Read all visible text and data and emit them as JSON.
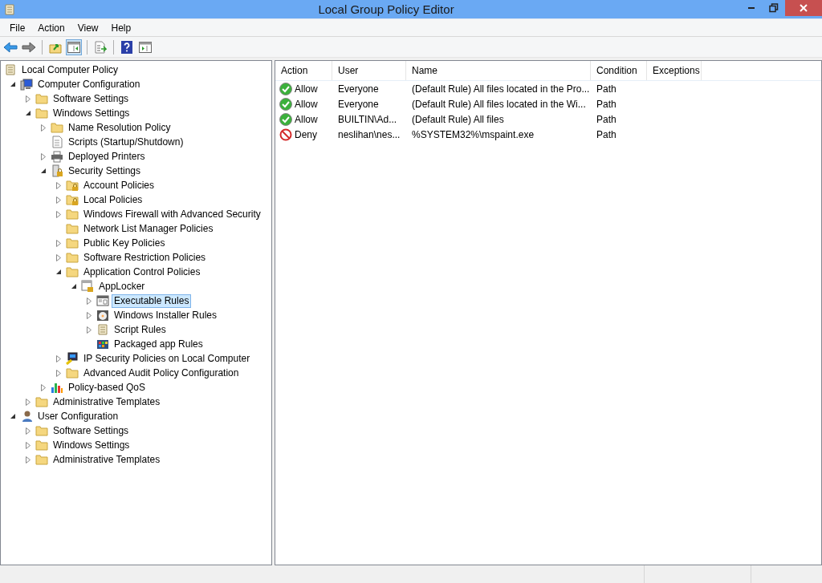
{
  "window": {
    "title": "Local Group Policy Editor"
  },
  "menu": [
    "File",
    "Action",
    "View",
    "Help"
  ],
  "toolbar": [
    {
      "kind": "back",
      "selected": false
    },
    {
      "kind": "forward",
      "selected": false
    },
    {
      "kind": "sep"
    },
    {
      "kind": "up-folder",
      "selected": false
    },
    {
      "kind": "show-tree",
      "selected": true
    },
    {
      "kind": "sep"
    },
    {
      "kind": "export",
      "selected": false
    },
    {
      "kind": "sep"
    },
    {
      "kind": "help",
      "selected": false
    },
    {
      "kind": "action-pane",
      "selected": false
    }
  ],
  "tree": [
    {
      "label": "Local Computer Policy",
      "kind": "scroll",
      "selected": false,
      "children": [
        {
          "label": "Computer Configuration",
          "kind": "computer",
          "selected": false,
          "expanded": true,
          "children": [
            {
              "label": "Software Settings",
              "kind": "folder",
              "selected": false,
              "expanded": false
            },
            {
              "label": "Windows Settings",
              "kind": "folder",
              "selected": false,
              "expanded": true,
              "children": [
                {
                  "label": "Name Resolution Policy",
                  "kind": "folder",
                  "selected": false,
                  "expanded": false
                },
                {
                  "label": "Scripts (Startup/Shutdown)",
                  "kind": "script",
                  "selected": false
                },
                {
                  "label": "Deployed Printers",
                  "kind": "printer",
                  "selected": false,
                  "expanded": false
                },
                {
                  "label": "Security Settings",
                  "kind": "security",
                  "selected": false,
                  "expanded": true,
                  "children": [
                    {
                      "label": "Account Policies",
                      "kind": "locked-folder",
                      "selected": false,
                      "expanded": false
                    },
                    {
                      "label": "Local Policies",
                      "kind": "locked-folder",
                      "selected": false,
                      "expanded": false
                    },
                    {
                      "label": "Windows Firewall with Advanced Security",
                      "kind": "folder",
                      "selected": false,
                      "expanded": false
                    },
                    {
                      "label": "Network List Manager Policies",
                      "kind": "folder",
                      "selected": false
                    },
                    {
                      "label": "Public Key Policies",
                      "kind": "folder",
                      "selected": false,
                      "expanded": false
                    },
                    {
                      "label": "Software Restriction Policies",
                      "kind": "folder",
                      "selected": false,
                      "expanded": false
                    },
                    {
                      "label": "Application Control Policies",
                      "kind": "folder",
                      "selected": false,
                      "expanded": true,
                      "children": [
                        {
                          "label": "AppLocker",
                          "kind": "applocker",
                          "selected": false,
                          "expanded": true,
                          "children": [
                            {
                              "label": "Executable Rules",
                              "kind": "window",
                              "selected": true,
                              "expanded": false
                            },
                            {
                              "label": "Windows Installer Rules",
                              "kind": "installer",
                              "selected": false,
                              "expanded": false
                            },
                            {
                              "label": "Script Rules",
                              "kind": "scroll",
                              "selected": false,
                              "expanded": false
                            },
                            {
                              "label": "Packaged app Rules",
                              "kind": "packaged",
                              "selected": false
                            }
                          ]
                        }
                      ]
                    },
                    {
                      "label": "IP Security Policies on Local Computer",
                      "kind": "ip-security",
                      "selected": false,
                      "expanded": false
                    },
                    {
                      "label": "Advanced Audit Policy Configuration",
                      "kind": "folder",
                      "selected": false,
                      "expanded": false
                    }
                  ]
                },
                {
                  "label": "Policy-based QoS",
                  "kind": "chart",
                  "selected": false,
                  "expanded": false
                }
              ]
            },
            {
              "label": "Administrative Templates",
              "kind": "folder",
              "selected": false,
              "expanded": false
            }
          ]
        },
        {
          "label": "User Configuration",
          "kind": "user",
          "selected": false,
          "expanded": true,
          "children": [
            {
              "label": "Software Settings",
              "kind": "folder",
              "selected": false,
              "expanded": false
            },
            {
              "label": "Windows Settings",
              "kind": "folder",
              "selected": false,
              "expanded": false
            },
            {
              "label": "Administrative Templates",
              "kind": "folder",
              "selected": false,
              "expanded": false
            }
          ]
        }
      ]
    }
  ],
  "table": {
    "columns": [
      "Action",
      "User",
      "Name",
      "Condition",
      "Exceptions"
    ],
    "rows": [
      {
        "kind": "allow",
        "action": "Allow",
        "user": "Everyone",
        "name": "(Default Rule) All files located in the Pro...",
        "condition": "Path"
      },
      {
        "kind": "allow",
        "action": "Allow",
        "user": "Everyone",
        "name": "(Default Rule) All files located in the Wi...",
        "condition": "Path"
      },
      {
        "kind": "allow",
        "action": "Allow",
        "user": "BUILTIN\\Ad...",
        "name": "(Default Rule) All files",
        "condition": "Path"
      },
      {
        "kind": "deny",
        "action": "Deny",
        "user": "neslihan\\nes...",
        "name": "%SYSTEM32%\\mspaint.exe",
        "condition": "Path"
      }
    ]
  }
}
